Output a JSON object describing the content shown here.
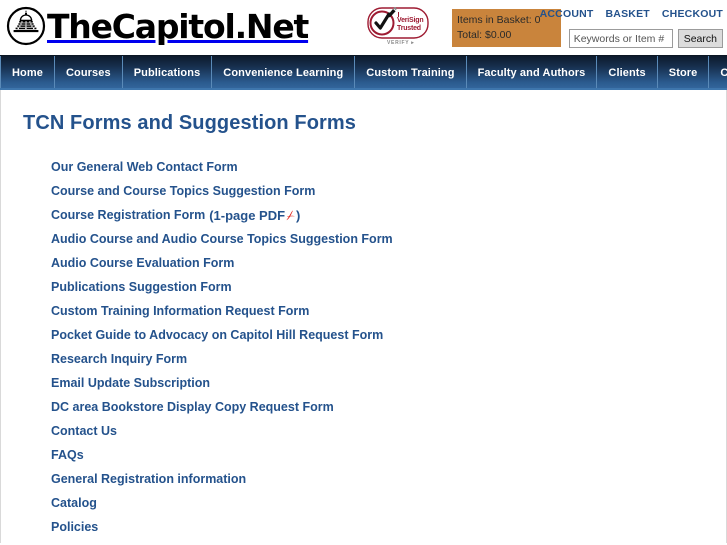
{
  "site": {
    "logo_text": "TheCapitol.Net",
    "logo_icon": "capitol-dome-icon"
  },
  "trust_badge": {
    "name": "verisign-trusted-seal",
    "line1": "VeriSign",
    "line2": "Trusted",
    "verify": "VERIFY ▸"
  },
  "basket": {
    "items_label": "Items in Basket: 0",
    "total_label": "Total: $0.00",
    "background_color": "#c9843c"
  },
  "account_links": [
    {
      "label": "ACCOUNT",
      "name": "account-link"
    },
    {
      "label": "BASKET",
      "name": "basket-link"
    },
    {
      "label": "CHECKOUT",
      "name": "checkout-link"
    }
  ],
  "search": {
    "value": "",
    "placeholder": "Keywords or Item #",
    "button_label": "Search"
  },
  "nav": {
    "accent_color": "#2b5b8f",
    "items": [
      {
        "label": "Home",
        "name": "nav-home"
      },
      {
        "label": "Courses",
        "name": "nav-courses"
      },
      {
        "label": "Publications",
        "name": "nav-publications"
      },
      {
        "label": "Convenience Learning",
        "name": "nav-convenience-learning"
      },
      {
        "label": "Custom Training",
        "name": "nav-custom-training"
      },
      {
        "label": "Faculty and Authors",
        "name": "nav-faculty-and-authors"
      },
      {
        "label": "Clients",
        "name": "nav-clients"
      },
      {
        "label": "Store",
        "name": "nav-store"
      },
      {
        "label": "Client Care",
        "name": "nav-client-care"
      }
    ]
  },
  "main": {
    "title": "TCN Forms and Suggestion Forms",
    "title_color": "#24528c",
    "link_color": "#24528c",
    "links": [
      {
        "label": "Our General Web Contact Form",
        "suffix": "",
        "pdf": false
      },
      {
        "label": "Course and Course Topics Suggestion Form",
        "suffix": "",
        "pdf": false
      },
      {
        "label": "Course Registration Form",
        "suffix_open": "(1-page PDF",
        "suffix_close": ")",
        "pdf": true
      },
      {
        "label": "Audio Course and Audio Course Topics Suggestion Form",
        "suffix": "",
        "pdf": false
      },
      {
        "label": "Audio Course Evaluation Form",
        "suffix": "",
        "pdf": false
      },
      {
        "label": "Publications Suggestion Form",
        "suffix": "",
        "pdf": false
      },
      {
        "label": "Custom Training Information Request Form",
        "suffix": "",
        "pdf": false
      },
      {
        "label": "Pocket Guide to Advocacy on Capitol Hill Request Form",
        "suffix": "",
        "pdf": false
      },
      {
        "label": "Research Inquiry Form",
        "suffix": "",
        "pdf": false
      },
      {
        "label": "Email Update Subscription",
        "suffix": "",
        "pdf": false
      },
      {
        "label": "DC area Bookstore Display Copy Request Form",
        "suffix": "",
        "pdf": false
      },
      {
        "label": "Contact Us",
        "suffix": "",
        "pdf": false
      },
      {
        "label": "FAQs",
        "suffix": "",
        "pdf": false
      },
      {
        "label": "General Registration information",
        "suffix": "",
        "pdf": false
      },
      {
        "label": "Catalog",
        "suffix": "",
        "pdf": false
      },
      {
        "label": "Policies",
        "suffix": "",
        "pdf": false
      }
    ]
  }
}
